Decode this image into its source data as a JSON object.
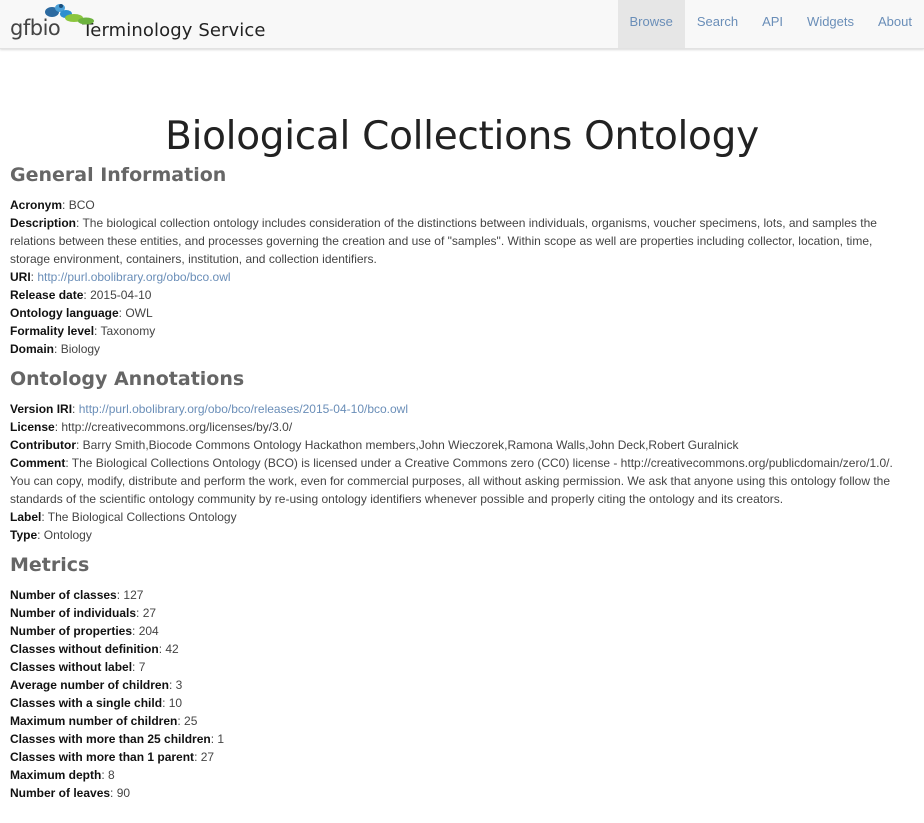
{
  "header": {
    "logo_gf": "gf",
    "logo_bio": "bio",
    "brand_title": "Terminology Service",
    "nav": [
      {
        "label": "Browse",
        "active": true
      },
      {
        "label": "Search",
        "active": false
      },
      {
        "label": "API",
        "active": false
      },
      {
        "label": "Widgets",
        "active": false
      },
      {
        "label": "About",
        "active": false
      }
    ]
  },
  "page_title": "Biological Collections Ontology",
  "general": {
    "heading": "General Information",
    "acronym": {
      "label": "Acronym",
      "value": "BCO"
    },
    "description": {
      "label": "Description",
      "value": "The biological collection ontology includes consideration of the distinctions between individuals, organisms, voucher specimens, lots, and samples the relations between these entities, and processes governing the creation and use of \"samples\". Within scope as well are properties including collector, location, time, storage environment, containers, institution, and collection identifiers."
    },
    "uri": {
      "label": "URI",
      "value": "http://purl.obolibrary.org/obo/bco.owl"
    },
    "release_date": {
      "label": "Release date",
      "value": "2015-04-10"
    },
    "language": {
      "label": "Ontology language",
      "value": "OWL"
    },
    "formality": {
      "label": "Formality level",
      "value": "Taxonomy"
    },
    "domain": {
      "label": "Domain",
      "value": "Biology"
    }
  },
  "annotations": {
    "heading": "Ontology Annotations",
    "version_iri": {
      "label": "Version IRI",
      "value": "http://purl.obolibrary.org/obo/bco/releases/2015-04-10/bco.owl"
    },
    "license": {
      "label": "License",
      "value": "http://creativecommons.org/licenses/by/3.0/"
    },
    "contributor": {
      "label": "Contributor",
      "value": "Barry Smith,Biocode Commons Ontology Hackathon members,John Wieczorek,Ramona Walls,John Deck,Robert Guralnick"
    },
    "comment": {
      "label": "Comment",
      "value": "The Biological Collections Ontology (BCO) is licensed under a Creative Commons zero (CC0) license - http://creativecommons.org/publicdomain/zero/1.0/. You can copy, modify, distribute and perform the work, even for commercial purposes, all without asking permission. We ask that anyone using this ontology follow the standards of the scientific ontology community by re-using ontology identifiers whenever possible and properly citing the ontology and its creators."
    },
    "label": {
      "label": "Label",
      "value": "The Biological Collections Ontology"
    },
    "type": {
      "label": "Type",
      "value": "Ontology"
    }
  },
  "metrics": {
    "heading": "Metrics",
    "items": [
      {
        "label": "Number of classes",
        "value": "127"
      },
      {
        "label": "Number of individuals",
        "value": "27"
      },
      {
        "label": "Number of properties",
        "value": "204"
      },
      {
        "label": "Classes without definition",
        "value": "42"
      },
      {
        "label": "Classes without label",
        "value": "7"
      },
      {
        "label": "Average number of children",
        "value": "3"
      },
      {
        "label": "Classes with a single child",
        "value": "10"
      },
      {
        "label": "Maximum number of children",
        "value": "25"
      },
      {
        "label": "Classes with more than 25 children",
        "value": "1"
      },
      {
        "label": "Classes with more than 1 parent",
        "value": "27"
      },
      {
        "label": "Maximum depth",
        "value": "8"
      },
      {
        "label": "Number of leaves",
        "value": "90"
      }
    ]
  }
}
